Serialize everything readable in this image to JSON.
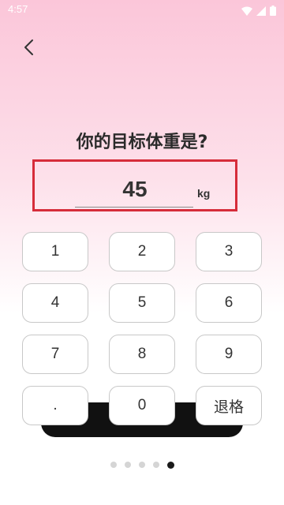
{
  "status_bar": {
    "time": "4:57",
    "icons": [
      "wifi-icon",
      "signal-icon",
      "battery-icon"
    ]
  },
  "header": {
    "back_icon": "chevron-left-icon"
  },
  "question": {
    "title": "你的目标体重是?"
  },
  "weight_input": {
    "value": "45",
    "unit": "kg",
    "highlight_color": "#d62c3a"
  },
  "keypad": {
    "keys": [
      "1",
      "2",
      "3",
      "4",
      "5",
      "6",
      "7",
      "8",
      "9",
      ".",
      "0",
      "退格"
    ]
  },
  "pager": {
    "total": 5,
    "active_index": 4
  },
  "colors": {
    "background_top": "#fbc6d9",
    "background_bottom": "#ffffff"
  }
}
